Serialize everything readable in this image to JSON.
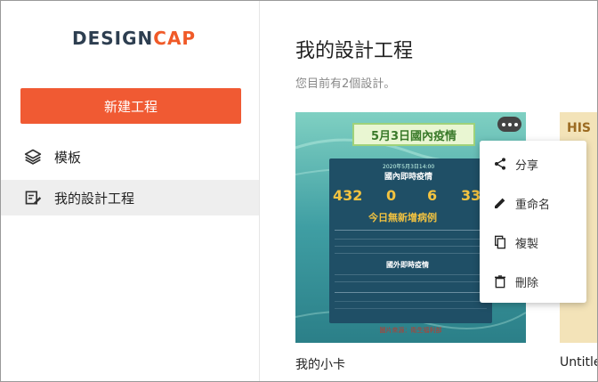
{
  "brand": {
    "logo_main": "DESIGN",
    "logo_accent": "CAP",
    "accent_color": "#f05a33"
  },
  "sidebar": {
    "new_project_label": "新建工程",
    "items": [
      {
        "label": "模板",
        "icon": "layers-icon",
        "active": false
      },
      {
        "label": "我的設計工程",
        "icon": "edit-document-icon",
        "active": true
      }
    ]
  },
  "main": {
    "title": "我的設計工程",
    "subtitle": "您目前有2個設計。",
    "cards": [
      {
        "name": "我的小卡",
        "poster": {
          "title": "5月3日國內疫情",
          "heading": "國內即時疫情",
          "stats": [
            "432",
            "0",
            "6",
            "332"
          ],
          "headline": "今日無新增病例",
          "global_heading": "國外即時疫情",
          "source": "圖片來源：衛生福利部"
        }
      },
      {
        "name": "Untitle",
        "poster": {
          "title": "HIS"
        }
      }
    ]
  },
  "context_menu": {
    "items": [
      {
        "label": "分享",
        "icon": "share-icon"
      },
      {
        "label": "重命名",
        "icon": "pencil-icon"
      },
      {
        "label": "複製",
        "icon": "copy-icon"
      },
      {
        "label": "刪除",
        "icon": "trash-icon"
      }
    ]
  }
}
